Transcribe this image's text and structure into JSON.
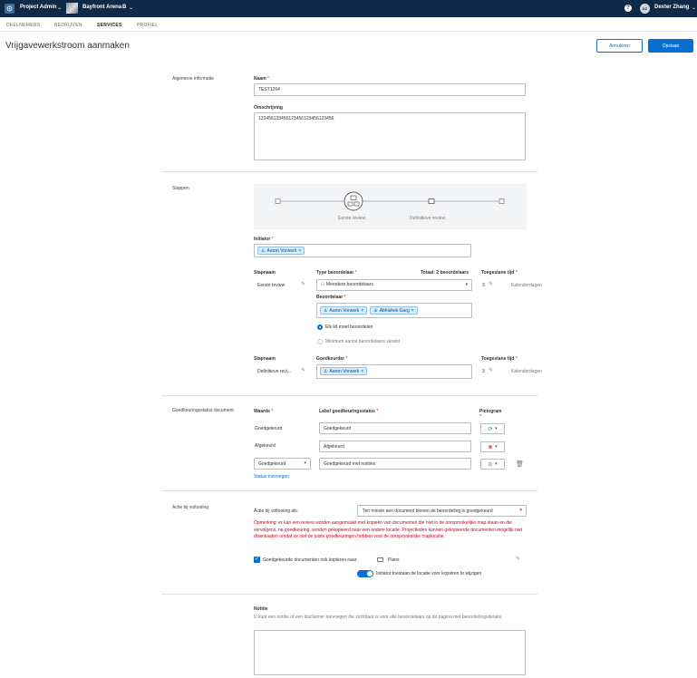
{
  "topbar": {
    "app_name": "Project Admin",
    "project_name": "Bayfront Arena",
    "project_suffix": "B",
    "help_icon": "help-icon",
    "user_name": "Dexter Zhang"
  },
  "nav": {
    "tabs": [
      "DEELNEMERS",
      "BEDRIJVEN",
      "SERVICES",
      "PROFIEL"
    ],
    "active": "SERVICES"
  },
  "page": {
    "title": "Vrijgavewerkstroom aanmaken",
    "cancel_label": "Annuleren",
    "save_label": "Opslaan"
  },
  "general": {
    "section_label": "Algemene informatie",
    "name_label": "Naam",
    "name_value": "TEST1264",
    "desc_label": "Omschrijving",
    "desc_value": "123456123456123456123456123456"
  },
  "steps": {
    "section_label": "Stappen",
    "flow_step1": "Eerste review",
    "flow_step2": "Definitieve review",
    "initiator_label": "Initiator",
    "initiator_chip": "Aaron Vorwerk",
    "step1": {
      "stepname_label": "Stapnaam",
      "stepname_value": "Eerste review",
      "type_label": "Type beoordelaar",
      "type_value": "Meerdere beoordelaars",
      "total_label": "Totaal: 2 beoordelaars",
      "time_label": "Toegestane tijd",
      "time_value": "3",
      "time_unit": "Kalenderdagen",
      "reviewer_label": "Beoordelaar",
      "reviewers": [
        "Aaron Vorwerk",
        "Abhishek Garg"
      ],
      "radio1": "Elk lid moet beoordelen",
      "radio2": "Minimum aantal beoordelaars vereist"
    },
    "step2": {
      "stepname_label": "Stapnaam",
      "stepname_value": "Definitieve revi...",
      "approver_label": "Goedkeurder",
      "approver_chip": "Aaron Vorwerk",
      "time_label": "Toegestane tijd",
      "time_value": "3",
      "time_unit": "Kalenderdagen"
    }
  },
  "status": {
    "section_label": "Goedkeuringsstatus document",
    "value_label": "Waarde",
    "label_label": "Label goedkeuringsstatus",
    "icon_label": "Pictogram",
    "rows": [
      {
        "value": "Goedgekeurd",
        "label": "Goedgekeurd"
      },
      {
        "value": "Afgekeurd",
        "label": "Afgekeurd"
      },
      {
        "value": "Goedgekeurd",
        "label": "Goedgekeurd met notities"
      }
    ],
    "add_link": "Status toevoegen"
  },
  "action": {
    "section_label": "Actie bij voltooiing",
    "when_label": "Actie bij voltooiing als:",
    "when_value": "Ten minste een document binnen de beoordeling is goedgekeurd",
    "warning": "Opmerking: er kan een review worden aangemaakt met kopieën van documenten die niet in de oorspronkelijke map staan en die vervolgens, na goedkeuring, worden gekopieerd naar een andere locatie. Projectleden kunnen gekopieerde documenten mogelijk niet downloaden omdat ze niet de juiste goedkeuringen hebben voor de oorspronkelijke maplocatie.",
    "copy_label": "Goedgekeurde documenten ook kopiëren naar:",
    "copy_target": "Plans",
    "toggle_label": "Initiator toestaan de locatie voor kopiëren te wijzigen"
  },
  "notes": {
    "label": "Notitie",
    "help": "U kunt een notitie of een disclaimer toevoegen die zichtbaar is voor alle beoordelaars op de pagina met beoordelingsdetails."
  },
  "colors": {
    "topbar": "#0f2a47",
    "accent": "#0a6ed1",
    "error": "#d0021b",
    "approved": "#2e9a3e"
  }
}
